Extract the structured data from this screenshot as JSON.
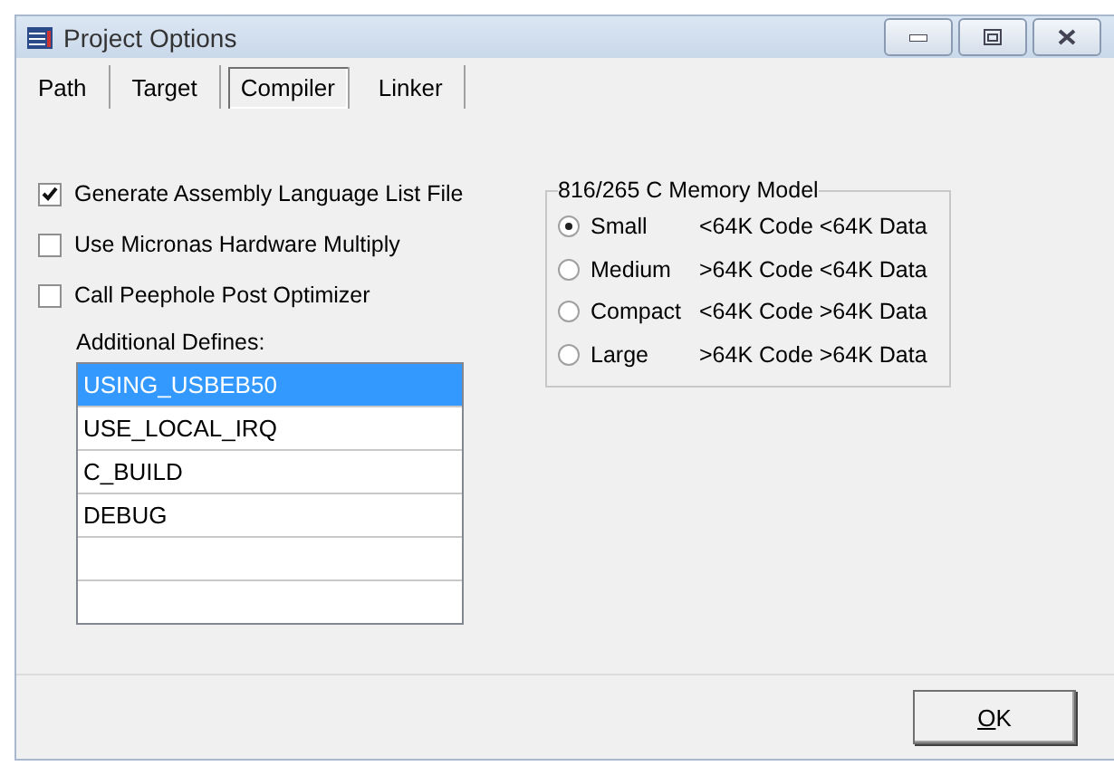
{
  "window": {
    "title": "Project Options"
  },
  "tabs": [
    {
      "label": "Path",
      "selected": false
    },
    {
      "label": "Target",
      "selected": false
    },
    {
      "label": "Compiler",
      "selected": true
    },
    {
      "label": "Linker",
      "selected": false
    }
  ],
  "options": [
    {
      "label": "Generate Assembly Language List File",
      "checked": true
    },
    {
      "label": "Use Micronas Hardware Multiply",
      "checked": false
    },
    {
      "label": "Call Peephole Post Optimizer",
      "checked": false
    }
  ],
  "defines": {
    "label": "Additional Defines:",
    "rows": [
      {
        "text": "USING_USBEB50",
        "selected": true
      },
      {
        "text": "USE_LOCAL_IRQ",
        "selected": false
      },
      {
        "text": "C_BUILD",
        "selected": false
      },
      {
        "text": "DEBUG",
        "selected": false
      }
    ]
  },
  "memory_model": {
    "title": "816/265 C Memory Model",
    "choices": [
      {
        "name": "Small",
        "description": "<64K Code <64K Data",
        "selected": true
      },
      {
        "name": "Medium",
        "description": ">64K Code <64K Data",
        "selected": false
      },
      {
        "name": "Compact",
        "description": "<64K Code >64K Data",
        "selected": false
      },
      {
        "name": "Large",
        "description": ">64K Code >64K Data",
        "selected": false
      }
    ]
  },
  "ok_button": {
    "label": "OK",
    "mnemonic_underlined": true
  }
}
